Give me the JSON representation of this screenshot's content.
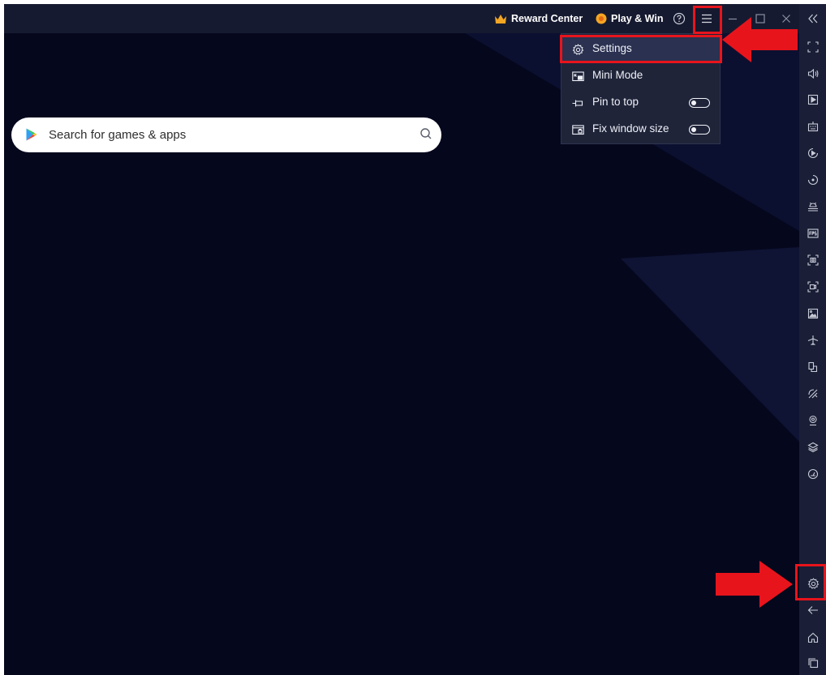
{
  "titlebar": {
    "reward_center_label": "Reward Center",
    "play_win_label": "Play & Win",
    "icons": [
      "crown-icon",
      "coin-icon",
      "help-icon",
      "hamburger-menu-icon",
      "minimize-icon",
      "maximize-icon",
      "close-icon",
      "collapse-sidebar-icon"
    ]
  },
  "search": {
    "placeholder": "Search for games & apps"
  },
  "menu": {
    "items": [
      {
        "label": "Settings",
        "icon": "gear-icon",
        "highlighted": true
      },
      {
        "label": "Mini Mode",
        "icon": "mini-mode-icon"
      },
      {
        "label": "Pin to top",
        "icon": "pin-icon",
        "toggle": false
      },
      {
        "label": "Fix window size",
        "icon": "fix-window-icon",
        "toggle": false
      }
    ]
  },
  "sidebar": {
    "icons": [
      "fullscreen-icon",
      "volume-icon",
      "media-icon",
      "keyboard-icon",
      "macro-record-icon",
      "rotate-icon",
      "install-apk-icon",
      "fps-icon",
      "screenshot-icon",
      "screen-record-icon",
      "media-manager-icon",
      "airplane-mode-icon",
      "multi-instance-icon",
      "eco-mode-icon",
      "location-icon",
      "layers-icon",
      "performance-icon",
      "settings-icon",
      "back-icon",
      "home-icon",
      "recent-apps-icon"
    ]
  },
  "colors": {
    "background": "#05071d",
    "titlebar": "#161a30",
    "sidebar": "#1a1e36",
    "menu": "#1f2439",
    "annotation_red": "#e8141c",
    "crown": "#f2a623",
    "coin": "#f5a623"
  }
}
